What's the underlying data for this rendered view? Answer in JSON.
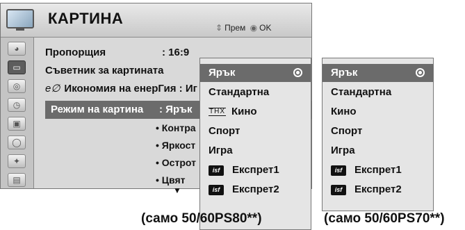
{
  "header": {
    "title": "КАРТИНА",
    "nav_hint_move": "Прем",
    "nav_hint_ok": "OK"
  },
  "sidebar": {
    "icons": [
      "satellite-dish-icon",
      "picture-icon",
      "speaker-icon",
      "clock-icon",
      "lock-icon",
      "usb-icon",
      "bluetooth-icon",
      "clapperboard-icon"
    ],
    "active_index": 1
  },
  "menu": {
    "aspect_label": "Пропорщия",
    "aspect_value": ": 16:9",
    "wizard_label": "Съветник за картината",
    "eco_prefix": "e∅",
    "eco_label": "Икономия на енерГия : Иг",
    "mode_label": "Режим на картина",
    "mode_value": ": Ярък",
    "sub_items": [
      "• Контра",
      "• Яркост",
      "• Острот",
      "• Цвят"
    ],
    "more_arrow": "▼"
  },
  "dropdown_80": {
    "items": [
      {
        "label": "Ярък",
        "selected": true
      },
      {
        "label": "Стандартна"
      },
      {
        "label": "Кино",
        "badge": "THX"
      },
      {
        "label": "Спорт"
      },
      {
        "label": "Игра"
      },
      {
        "label": "Експрет1",
        "badge": "isf"
      },
      {
        "label": "Експрет2",
        "badge": "isf"
      }
    ],
    "note": "(само 50/60PS80**)"
  },
  "dropdown_70": {
    "items": [
      {
        "label": "Ярък",
        "selected": true
      },
      {
        "label": "Стандартна"
      },
      {
        "label": "Кино"
      },
      {
        "label": "Спорт"
      },
      {
        "label": "Игра"
      },
      {
        "label": "Експрет1",
        "badge": "isf"
      },
      {
        "label": "Експрет2",
        "badge": "isf"
      }
    ],
    "note": "(само 50/60PS70**)"
  }
}
